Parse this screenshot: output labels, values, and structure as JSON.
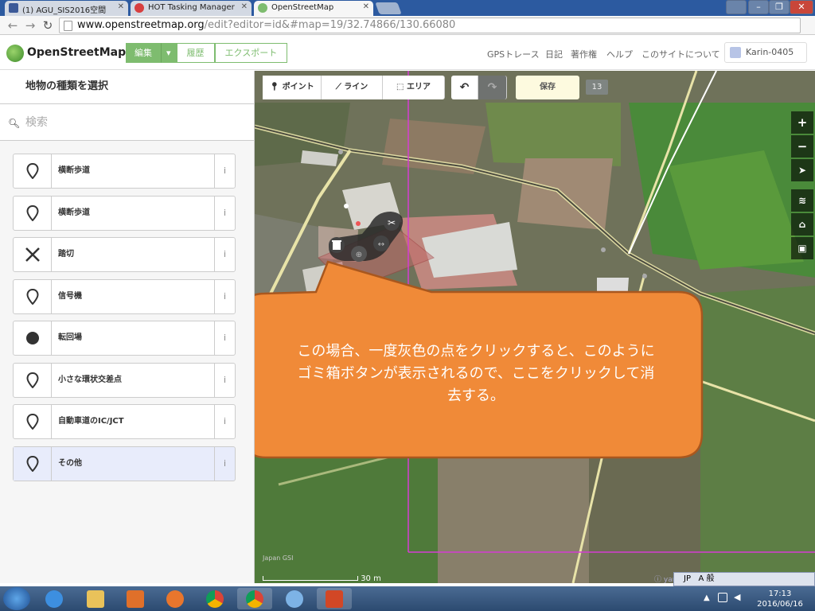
{
  "browser": {
    "tabs": [
      {
        "title": "(1) AGU_SIS2016空間",
        "active": false
      },
      {
        "title": "HOT Tasking Manager",
        "active": false
      },
      {
        "title": "OpenStreetMap",
        "active": true
      }
    ],
    "url_host": "www.openstreetmap.org",
    "url_path": "/edit?editor=id&#map=19/32.74866/130.66080"
  },
  "osm_header": {
    "logo_text": "OpenStreetMap",
    "edit_label": "編集",
    "history_label": "履歴",
    "export_label": "エクスポート",
    "nav": [
      "GPSトレース",
      "日記",
      "著作権",
      "ヘルプ",
      "このサイトについて"
    ],
    "username": "Karin-0405"
  },
  "sidebar": {
    "title": "地物の種類を選択",
    "search_placeholder": "検索",
    "presets": [
      {
        "label": "横断歩道",
        "icon": "pin-icon",
        "selected": false
      },
      {
        "label": "横断歩道",
        "icon": "pin-icon",
        "selected": false
      },
      {
        "label": "踏切",
        "icon": "cross-icon",
        "selected": false
      },
      {
        "label": "信号機",
        "icon": "pin-icon",
        "selected": false
      },
      {
        "label": "転回場",
        "icon": "dot-icon",
        "selected": false
      },
      {
        "label": "小さな環状交差点",
        "icon": "pin-icon",
        "selected": false
      },
      {
        "label": "自動車道のIC/JCT",
        "icon": "pin-icon",
        "selected": false
      },
      {
        "label": "その他",
        "icon": "pin-icon",
        "selected": true
      }
    ],
    "info_label": "i"
  },
  "map_toolbar": {
    "point": "ポイント",
    "line": "ライン",
    "area": "エリア",
    "save": "保存",
    "change_count": "13"
  },
  "callout": {
    "line1": "この場合、一度灰色の点をクリックすると、このように",
    "line2": "ゴミ箱ボタンが表示されるので、ここをクリックして消",
    "line3": "去する。"
  },
  "map_footer": {
    "scale": "30 m",
    "attribution": "Japan GSI",
    "user": "yame"
  },
  "ime_bar": {
    "lang": "JP",
    "mode": "A 般"
  },
  "clock": {
    "time": "17:13",
    "date": "2016/06/16"
  }
}
